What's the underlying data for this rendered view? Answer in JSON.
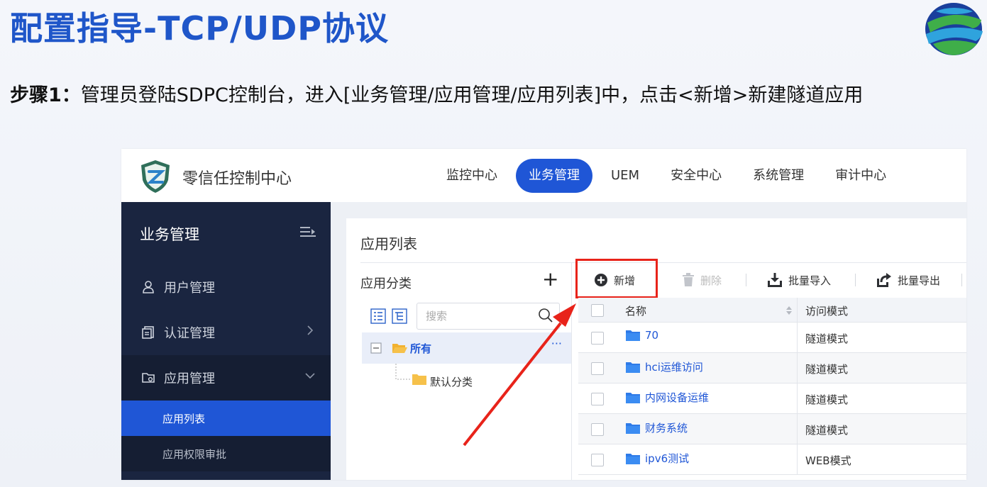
{
  "slide": {
    "title": "配置指导-TCP/UDP协议",
    "step_label": "步骤1：",
    "step_text": "管理员登陆SDPC控制台，进入[业务管理/应用管理/应用列表]中，点击<新增>新建隧道应用"
  },
  "app": {
    "name": "零信任控制中心",
    "nav": [
      "监控中心",
      "业务管理",
      "UEM",
      "安全中心",
      "系统管理",
      "审计中心"
    ],
    "nav_active": "业务管理",
    "colors": {
      "primary": "#1f56d6",
      "sidebar": "#1a2540",
      "highlight": "#e8231a"
    }
  },
  "sidebar": {
    "title": "业务管理",
    "items": [
      {
        "label": "用户管理",
        "icon": "user-icon"
      },
      {
        "label": "认证管理",
        "icon": "document-icon"
      },
      {
        "label": "应用管理",
        "icon": "app-folder-icon"
      }
    ],
    "sub_items": [
      {
        "label": "应用列表",
        "active": true
      },
      {
        "label": "应用权限审批",
        "active": false
      }
    ]
  },
  "panel": {
    "title": "应用列表",
    "category": {
      "title": "应用分类",
      "add": "+",
      "search_placeholder": "搜索",
      "root": "所有",
      "root_more": "···",
      "child": "默认分类"
    },
    "toolbar": {
      "add": "新增",
      "delete": "删除",
      "import": "批量导入",
      "export": "批量导出"
    },
    "table": {
      "columns": [
        "名称",
        "访问模式"
      ],
      "rows": [
        {
          "name": "70",
          "mode": "隧道模式"
        },
        {
          "name": "hci运维访问",
          "mode": "隧道模式"
        },
        {
          "name": "内网设备运维",
          "mode": "隧道模式"
        },
        {
          "name": "财务系统",
          "mode": "隧道模式"
        },
        {
          "name": "ipv6测试",
          "mode": "WEB模式"
        }
      ]
    }
  }
}
